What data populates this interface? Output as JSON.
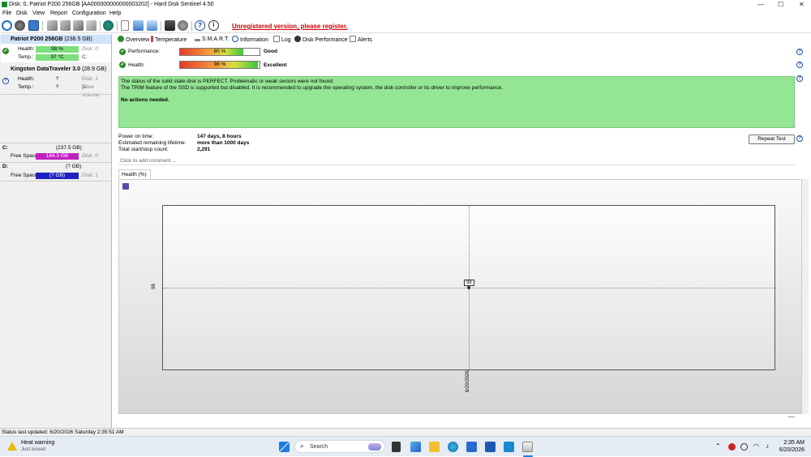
{
  "window": {
    "title": "Disk: 0, Patriot P200 256GB [AA000000000000003202]  -  Hard Disk Sentinel 4.50",
    "minimize": "—",
    "maximize": "☐",
    "close": "✕"
  },
  "menu": [
    "File",
    "Disk",
    "View",
    "Report",
    "Configuration",
    "Help"
  ],
  "toolbar": {
    "unregistered": "Unregistered version, please register."
  },
  "disks": [
    {
      "name": "Patriot P200 256GB",
      "size": "(238.5 GB)",
      "health_label": "Health:",
      "health_value": "98 %",
      "health_disk": "Disk: 0",
      "temp_label": "Temp.:",
      "temp_value": "37 °C",
      "temp_drive": "C:"
    },
    {
      "name": "Kingston DataTraveler 3.0",
      "size": "(28.9 GB)",
      "health_label": "Health:",
      "health_value": "?",
      "health_disk": "Disk: 1",
      "temp_label": "Temp.:",
      "temp_value": "?",
      "temp_drive": "D:",
      "temp_volume": "[New Volume"
    }
  ],
  "volumes": [
    {
      "letter": "C:",
      "size": "(237.5 GB)",
      "free_label": "Free Space",
      "free_value": "184.3 GB",
      "disk": "Disk: 0",
      "color": "#c020c0"
    },
    {
      "letter": "D:",
      "size": "(? GB)",
      "free_label": "Free Space",
      "free_value": "(? GB)",
      "disk": "Disk: 1",
      "color": "#2020c0"
    }
  ],
  "tabs": [
    "Overview",
    "Temperature",
    "S.M.A.R.T.",
    "Information",
    "Log",
    "Disk Performance",
    "Alerts"
  ],
  "overview": {
    "performance_label": "Performance:",
    "performance_value": "80 %",
    "performance_fraction": 0.8,
    "performance_rating": "Good",
    "health_label": "Health:",
    "health_value": "98 %",
    "health_fraction": 0.98,
    "health_rating": "Excellent",
    "status_lines": [
      "The status of the solid state disk is PERFECT. Problematic or weak sectors were not found.",
      "The TRIM feature of the SSD is supported but disabled. It is recommended to upgrade the operating system, the disk controller or its driver to improve performance."
    ],
    "actions": "No actions needed.",
    "power_on_label": "Power on time:",
    "power_on_value": "147 days, 8 hours",
    "lifetime_label": "Estimated remaining lifetime:",
    "lifetime_value": "more than 1000 days",
    "startstop_label": "Total start/stop count:",
    "startstop_value": "2,291",
    "repeat_button": "Repeat Test",
    "comment_placeholder": "Click to add comment ..."
  },
  "health_chart": {
    "tab_label": "Health (%)",
    "y_tick": "98",
    "point_label": "98",
    "x_tick": "6/20/2026"
  },
  "statusbar": {
    "text": "Status last updated: 6/20/2026 Saturday 2:35:51 AM"
  },
  "taskbar": {
    "notif_title": "Heat warning",
    "notif_sub": "Just issued",
    "search_placeholder": "Search",
    "time": "2:35 AM",
    "date": "6/20/2026"
  }
}
